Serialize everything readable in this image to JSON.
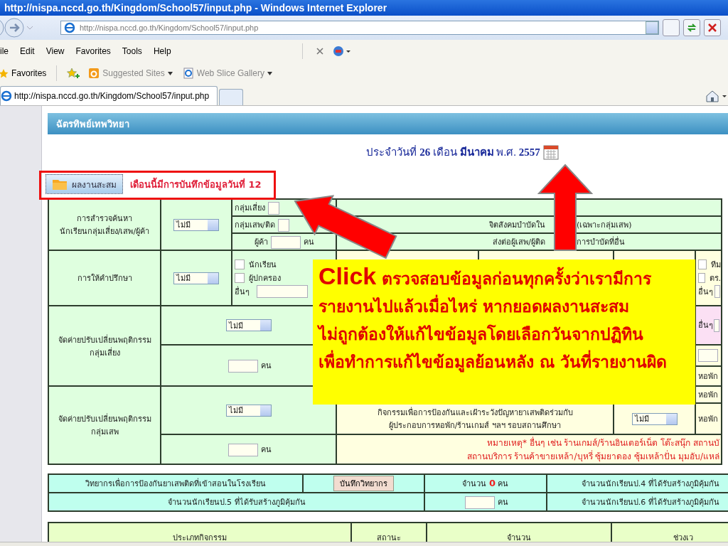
{
  "window": {
    "title": "http://nispa.nccd.go.th/Kingdom/School57/input.php - Windows Internet Explorer"
  },
  "address_bar": {
    "value": "http://nispa.nccd.go.th/Kingdom/School57/input.php"
  },
  "menu": [
    "ile",
    "Edit",
    "View",
    "Favorites",
    "Tools",
    "Help"
  ],
  "favorites_bar": {
    "label": "Favorites",
    "links": [
      "Suggested Sites",
      "Web Slice Gallery"
    ]
  },
  "tab": {
    "label": "http://nispa.nccd.go.th/Kingdom/School57/input.php"
  },
  "page": {
    "school": "ฉัตรทิพย์เทพวิทยา",
    "date_line": "ประจำวันที่ **26** เดือน **มีนาคม** พ.ศ. **2557**",
    "summary_button": "ผลงานสะสม",
    "record_note": "เดือนนี้มีการบันทึกข้อมูลวันที่ 12"
  },
  "survey": {
    "label": [
      "การสำรวจค้นหา",
      "นักเรียนกลุ่มเสี่ยง/เสพ/ผู้ค้า"
    ],
    "select": "ไม่มี",
    "counts": [
      {
        "label": "กลุ่มเสี่ยง"
      },
      {
        "label": "กลุ่มเสพ/ติด"
      },
      {
        "label": "ผู้ค้า",
        "unit": "คน"
      }
    ],
    "referral": [
      [
        "จิตสังคมบำบัดใน",
        "(เฉพาะกลุ่มเสพ)"
      ],
      [
        "ส่งต่อผู้เสพ/ผู้ติด",
        "การบำบัดที่อื่น"
      ]
    ]
  },
  "counseling": {
    "label": "การให้คำปรึกษา",
    "select": "ไม่มี",
    "options": [
      {
        "label": "นักเรียน",
        "checked": false
      },
      {
        "label": "ผู้ปกครอง",
        "checked": false
      }
    ],
    "other_label": "อื่นๆ",
    "edge_options": [
      {
        "label": "ทีม",
        "checked": false
      },
      {
        "label": "ตร.",
        "checked": false
      }
    ],
    "edge_other": "อื่นๆ"
  },
  "camps": [
    {
      "label": [
        "จัดค่ายปรับเปลี่ยนพฤติกรรม",
        "กลุ่มเสี่ยง"
      ],
      "select": "ไม่มี",
      "unit": "คน",
      "edge_other": "อื่นๆ",
      "edge_labels": [
        "หอพัก"
      ]
    },
    {
      "label": [
        "จัดค่ายปรับเปลี่ยนพฤติกรรม",
        "กลุ่มเสพ"
      ],
      "select": "ไม่มี",
      "unit": "คน",
      "edge_labels": [
        "หอพัก"
      ]
    }
  ],
  "partner_activity": {
    "text": [
      "กิจกรรมเพื่อการป้องกันและเฝ้าระวังปัญหายาเสพติดร่วมกับ",
      "ผู้ประกอบการหอพัก/ร้านเกมส์ ฯลฯ รอบสถานศึกษา"
    ],
    "select": "ไม่มี",
    "edge_label": "หอพัก"
  },
  "note": [
    "หมายเหตุ* อื่นๆ เช่น ร้านเกมส์/ร้านอินเตอร์เน็ต โต๊ะสนุ๊ก สถานบั",
    "สถานบริการ ร้านค้าขายเหล้า/บุหรี่ ซุ้มยาดอง ซุ้มเหล้าปั่น มุมอับ/แหล่"
  ],
  "speakers": {
    "label": "วิทยากรเพื่อการป้องกันยาเสพติดที่เข้าสอนในโรงเรียน",
    "button": "บันทึกวิทยากร",
    "count_label": "จำนวน",
    "count": "0",
    "unit": "คน",
    "p4": "จำนวนนักเรียนป.4 ที่ได้รับสร้างภูมิคุ้มกัน",
    "p5": "จำนวนนักเรียนป.5 ที่ได้รับสร้างภูมิคุ้มกัน",
    "p5_unit": "คน",
    "p6": "จำนวนนักเรียนป.6 ที่ได้รับสร้างภูมิคุ้มกัน"
  },
  "activity_table": {
    "columns": [
      "ประเภทกิจกรรม",
      "สถานะ",
      "จำนวน",
      "ช่วงเว"
    ]
  },
  "callout": {
    "keyword": "Click",
    "lines": [
      "ตรวจสอบข้อมูลก่อนทุกครั้งว่าเรามีการ",
      "รายงานไปแล้วเมื่อไหร่ หากยอดผลงานสะสม",
      "ไม่ถูกต้องให้แก้ไขข้อมูลโดยเลือกวันจากปฏิทิน",
      "เพื่อทำการแก้ไขข้อมูลย้อนหลัง ณ วันที่รายงานผิด"
    ]
  }
}
